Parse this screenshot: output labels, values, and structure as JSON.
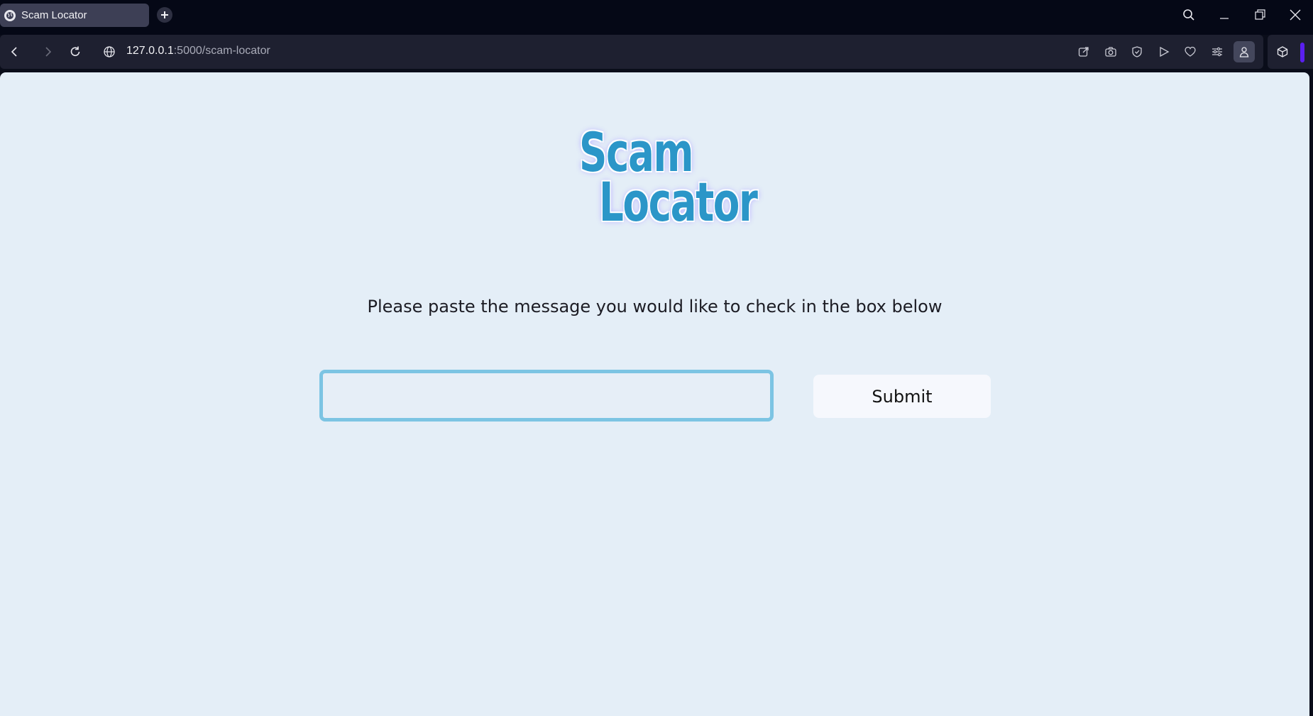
{
  "browser": {
    "tab": {
      "title": "Scam Locator"
    },
    "address": {
      "host": "127.0.0.1",
      "rest": ":5000/scam-locator"
    },
    "icons": {
      "back": "back-arrow-icon",
      "forward": "forward-arrow-icon",
      "reload": "reload-icon",
      "site_info": "globe-icon",
      "search": "search-icon",
      "minimize": "minimize-icon",
      "restore": "restore-icon",
      "close": "close-icon",
      "accent_color": "#5a1ff0"
    }
  },
  "page": {
    "logo": {
      "line1": "Scam",
      "line2": "Locator",
      "color": "#2b96c8"
    },
    "prompt": "Please paste the message you would like to check in the box below",
    "input": {
      "value": "",
      "placeholder": ""
    },
    "submit_label": "Submit",
    "background": "#e4eef7"
  }
}
